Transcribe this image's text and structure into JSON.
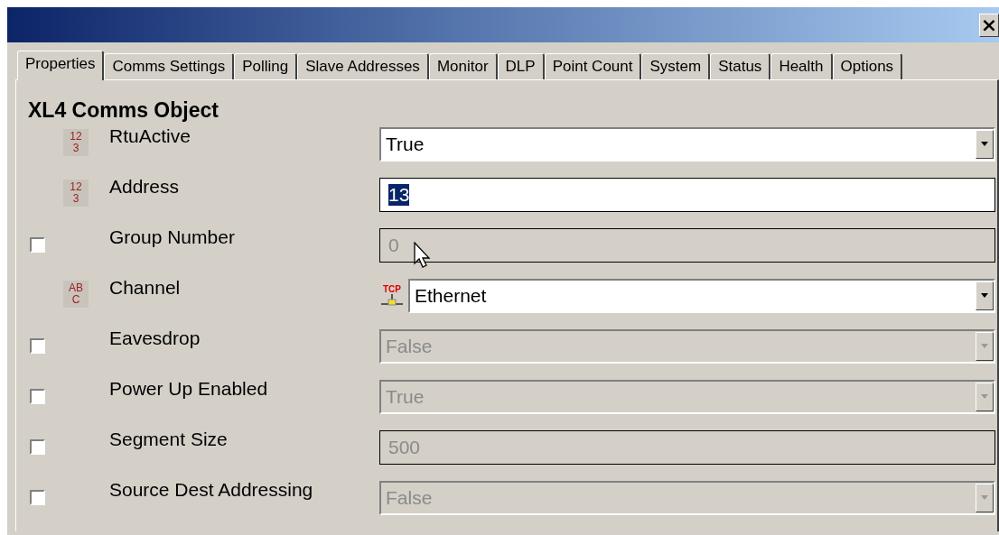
{
  "window": {
    "close": "×"
  },
  "tabs": [
    {
      "label": "Properties",
      "selected": true
    },
    {
      "label": "Comms Settings",
      "selected": false
    },
    {
      "label": "Polling",
      "selected": false
    },
    {
      "label": "Slave Addresses",
      "selected": false
    },
    {
      "label": "Monitor",
      "selected": false
    },
    {
      "label": "DLP",
      "selected": false
    },
    {
      "label": "Point Count",
      "selected": false
    },
    {
      "label": "System",
      "selected": false
    },
    {
      "label": "Status",
      "selected": false
    },
    {
      "label": "Health",
      "selected": false
    },
    {
      "label": "Options",
      "selected": false
    }
  ],
  "heading": "XL4 Comms Object",
  "rows": [
    {
      "label": "RtuActive",
      "type_badge": [
        "12",
        "3"
      ],
      "control": {
        "kind": "dropdown",
        "value": "True",
        "disabled": false
      }
    },
    {
      "label": "Address",
      "type_badge": [
        "12",
        "3"
      ],
      "control": {
        "kind": "field",
        "value": "13",
        "disabled": false,
        "text_selected": true
      }
    },
    {
      "label": "Group Number",
      "checked": false,
      "control": {
        "kind": "field",
        "value": "0",
        "disabled": true,
        "text_selected": false
      }
    },
    {
      "label": "Channel",
      "type_badge": [
        "AB",
        "C"
      ],
      "control": {
        "kind": "dropdown",
        "value": "Ethernet",
        "disabled": false,
        "prefix_icon": "TCP"
      }
    },
    {
      "label": "Eavesdrop",
      "checked": false,
      "control": {
        "kind": "dropdown",
        "value": "False",
        "disabled": true
      }
    },
    {
      "label": "Power Up Enabled",
      "checked": false,
      "control": {
        "kind": "dropdown",
        "value": "True",
        "disabled": true
      }
    },
    {
      "label": "Segment Size",
      "checked": false,
      "control": {
        "kind": "field",
        "value": "500",
        "disabled": true,
        "text_selected": false
      }
    },
    {
      "label": "Source Dest Addressing",
      "checked": false,
      "control": {
        "kind": "dropdown",
        "value": "False",
        "disabled": true
      }
    }
  ]
}
